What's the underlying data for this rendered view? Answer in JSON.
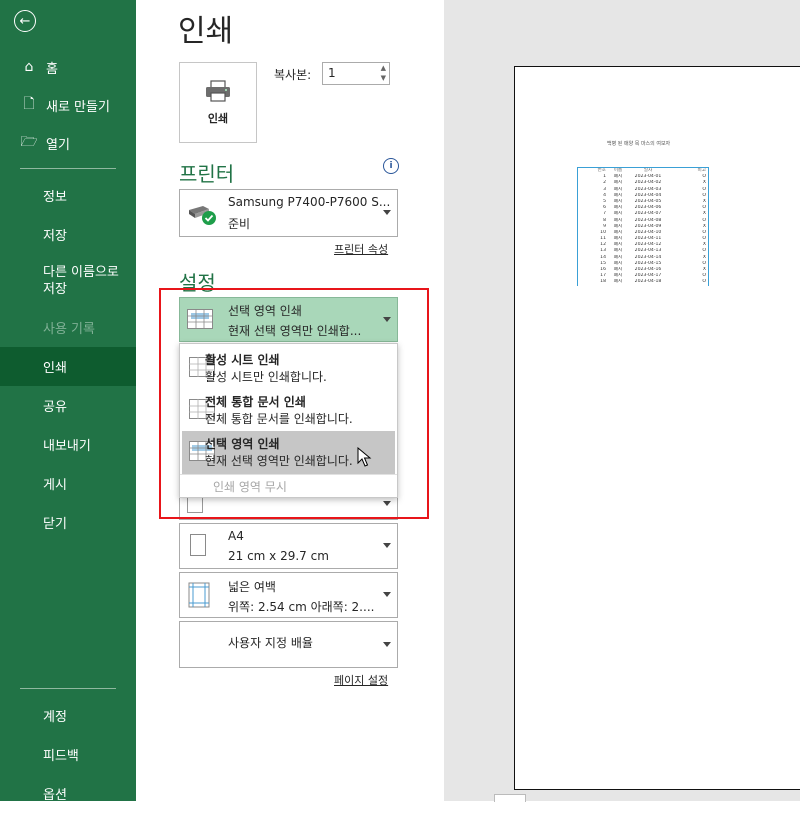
{
  "sidebar": {
    "back_icon": "back-arrow-icon",
    "top_items": [
      {
        "label": "홈",
        "icon": "home-icon",
        "glyph": "⌂"
      },
      {
        "label": "새로 만들기",
        "icon": "new-document-icon",
        "glyph": "🗋"
      },
      {
        "label": "열기",
        "icon": "open-folder-icon",
        "glyph": "🗁"
      }
    ],
    "items": [
      {
        "label": "정보"
      },
      {
        "label": "저장"
      },
      {
        "label": "다른 이름으로 저장"
      },
      {
        "label": "사용 기록"
      },
      {
        "label": "인쇄"
      },
      {
        "label": "공유"
      },
      {
        "label": "내보내기"
      },
      {
        "label": "게시"
      },
      {
        "label": "닫기"
      }
    ],
    "bottom_items": [
      {
        "label": "계정"
      },
      {
        "label": "피드백"
      },
      {
        "label": "옵션"
      }
    ],
    "colors": {
      "background": "#217346",
      "active": "#0e5c2f"
    }
  },
  "main": {
    "title": "인쇄",
    "print_button_label": "인쇄",
    "copies_label": "복사본:",
    "copies_value": "1",
    "printer_section": "프린터",
    "printer": {
      "name": "Samsung P7400-P7600 S...",
      "status": "준비"
    },
    "printer_properties_link": "프린터 속성",
    "settings_section": "설정",
    "print_what": {
      "title": "선택 영역 인쇄",
      "desc": "현재 선택 영역만 인쇄합..."
    },
    "popup": {
      "options": [
        {
          "title": "활성 시트 인쇄",
          "desc": "활성 시트만 인쇄합니다."
        },
        {
          "title": "전체 통합 문서 인쇄",
          "desc": "전체 통합 문서를 인쇄합니다."
        },
        {
          "title": "선택 영역 인쇄",
          "desc": "현재 선택 영역만 인쇄합니다."
        }
      ],
      "ignore_print_area": "인쇄 영역 무시"
    },
    "paper": {
      "title": "A4",
      "desc": "21 cm x 29.7 cm"
    },
    "margins": {
      "title": "넓은 여백",
      "desc": "위쪽: 2.54 cm 아래쪽: 2...."
    },
    "scaling": {
      "title": "사용자 지정 배율"
    },
    "page_setup_link": "페이지 설정"
  },
  "preview": {
    "title": "백병 된 매양 목 마스의 여보자",
    "headers": [
      "번호",
      "이름",
      "일자",
      "비고"
    ],
    "rows": [
      [
        "1",
        "폐지",
        "2023-04-01",
        "O"
      ],
      [
        "2",
        "폐지",
        "2023-04-02",
        "X"
      ],
      [
        "3",
        "폐지",
        "2023-04-03",
        "O"
      ],
      [
        "4",
        "폐지",
        "2023-04-04",
        "O"
      ],
      [
        "5",
        "폐지",
        "2023-04-05",
        "X"
      ],
      [
        "6",
        "폐지",
        "2023-04-06",
        "O"
      ],
      [
        "7",
        "폐지",
        "2023-04-07",
        "X"
      ],
      [
        "8",
        "폐지",
        "2023-04-08",
        "O"
      ],
      [
        "9",
        "폐지",
        "2023-04-09",
        "X"
      ],
      [
        "10",
        "폐지",
        "2023-04-10",
        "O"
      ],
      [
        "11",
        "폐지",
        "2023-04-11",
        "O"
      ],
      [
        "12",
        "폐지",
        "2023-04-12",
        "X"
      ],
      [
        "13",
        "폐지",
        "2023-04-13",
        "O"
      ],
      [
        "14",
        "폐지",
        "2023-04-14",
        "X"
      ],
      [
        "15",
        "폐지",
        "2023-04-15",
        "O"
      ],
      [
        "16",
        "폐지",
        "2023-04-16",
        "X"
      ],
      [
        "17",
        "폐지",
        "2023-04-17",
        "O"
      ],
      [
        "18",
        "폐지",
        "2023-04-18",
        "O"
      ]
    ]
  }
}
